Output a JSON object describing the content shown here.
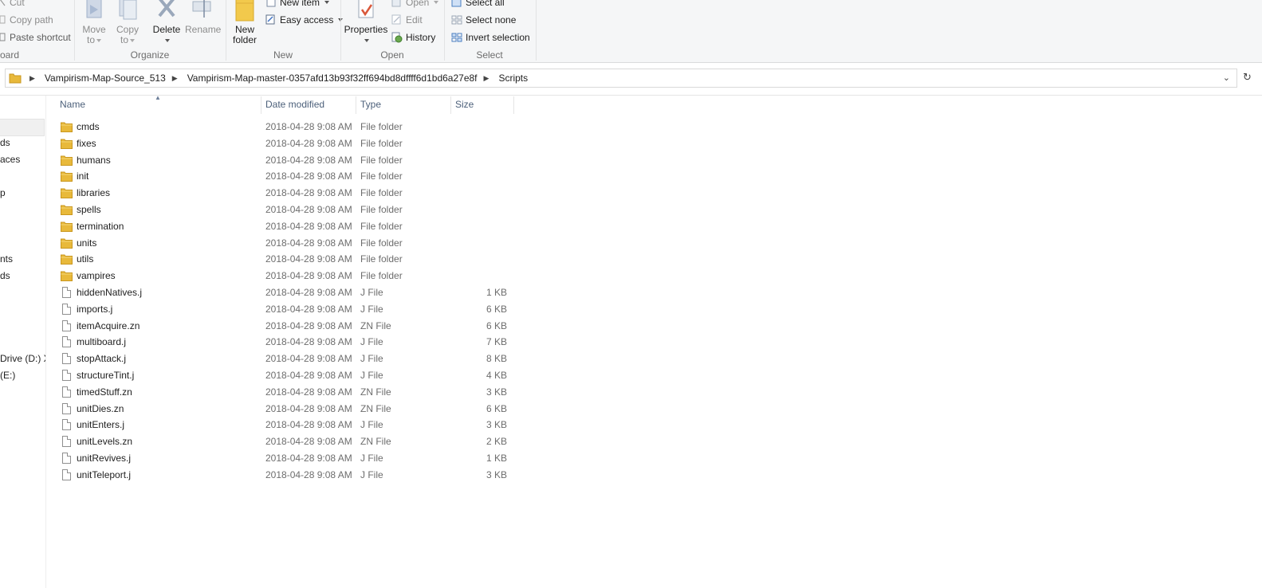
{
  "ribbon": {
    "clipboard": {
      "cut": "Cut",
      "copy_path": "Copy path",
      "paste_shortcut": "Paste shortcut",
      "label": "oard"
    },
    "organize": {
      "move_to_1": "Move",
      "move_to_2": "to",
      "copy_to_1": "Copy",
      "copy_to_2": "to",
      "delete": "Delete",
      "rename": "Rename",
      "label": "Organize"
    },
    "new": {
      "new_folder_1": "New",
      "new_folder_2": "folder",
      "new_item": "New item",
      "easy_access": "Easy access",
      "label": "New"
    },
    "open": {
      "properties": "Properties",
      "open": "Open",
      "edit": "Edit",
      "history": "History",
      "label": "Open"
    },
    "select": {
      "select_all": "Select all",
      "select_none": "Select none",
      "invert_selection": "Invert selection",
      "label": "Select"
    }
  },
  "address": {
    "crumbs": [
      "Vampirism-Map-Source_513",
      "Vampirism-Map-master-0357afd13b93f32ff694bd8dffff6d1bd6a27e8f",
      "Scripts"
    ]
  },
  "nav": {
    "items": [
      "ds",
      "aces",
      "p",
      "nts",
      "ds",
      "Drive (D:) X",
      "(E:)"
    ]
  },
  "columns": {
    "name": "Name",
    "date": "Date modified",
    "type": "Type",
    "size": "Size"
  },
  "files": [
    {
      "name": "cmds",
      "date": "2018-04-28 9:08 AM",
      "type": "File folder",
      "size": "",
      "kind": "folder"
    },
    {
      "name": "fixes",
      "date": "2018-04-28 9:08 AM",
      "type": "File folder",
      "size": "",
      "kind": "folder"
    },
    {
      "name": "humans",
      "date": "2018-04-28 9:08 AM",
      "type": "File folder",
      "size": "",
      "kind": "folder"
    },
    {
      "name": "init",
      "date": "2018-04-28 9:08 AM",
      "type": "File folder",
      "size": "",
      "kind": "folder"
    },
    {
      "name": "libraries",
      "date": "2018-04-28 9:08 AM",
      "type": "File folder",
      "size": "",
      "kind": "folder"
    },
    {
      "name": "spells",
      "date": "2018-04-28 9:08 AM",
      "type": "File folder",
      "size": "",
      "kind": "folder"
    },
    {
      "name": "termination",
      "date": "2018-04-28 9:08 AM",
      "type": "File folder",
      "size": "",
      "kind": "folder"
    },
    {
      "name": "units",
      "date": "2018-04-28 9:08 AM",
      "type": "File folder",
      "size": "",
      "kind": "folder"
    },
    {
      "name": "utils",
      "date": "2018-04-28 9:08 AM",
      "type": "File folder",
      "size": "",
      "kind": "folder"
    },
    {
      "name": "vampires",
      "date": "2018-04-28 9:08 AM",
      "type": "File folder",
      "size": "",
      "kind": "folder"
    },
    {
      "name": "hiddenNatives.j",
      "date": "2018-04-28 9:08 AM",
      "type": "J File",
      "size": "1 KB",
      "kind": "file"
    },
    {
      "name": "imports.j",
      "date": "2018-04-28 9:08 AM",
      "type": "J File",
      "size": "6 KB",
      "kind": "file"
    },
    {
      "name": "itemAcquire.zn",
      "date": "2018-04-28 9:08 AM",
      "type": "ZN File",
      "size": "6 KB",
      "kind": "file"
    },
    {
      "name": "multiboard.j",
      "date": "2018-04-28 9:08 AM",
      "type": "J File",
      "size": "7 KB",
      "kind": "file"
    },
    {
      "name": "stopAttack.j",
      "date": "2018-04-28 9:08 AM",
      "type": "J File",
      "size": "8 KB",
      "kind": "file"
    },
    {
      "name": "structureTint.j",
      "date": "2018-04-28 9:08 AM",
      "type": "J File",
      "size": "4 KB",
      "kind": "file"
    },
    {
      "name": "timedStuff.zn",
      "date": "2018-04-28 9:08 AM",
      "type": "ZN File",
      "size": "3 KB",
      "kind": "file"
    },
    {
      "name": "unitDies.zn",
      "date": "2018-04-28 9:08 AM",
      "type": "ZN File",
      "size": "6 KB",
      "kind": "file"
    },
    {
      "name": "unitEnters.j",
      "date": "2018-04-28 9:08 AM",
      "type": "J File",
      "size": "3 KB",
      "kind": "file"
    },
    {
      "name": "unitLevels.zn",
      "date": "2018-04-28 9:08 AM",
      "type": "ZN File",
      "size": "2 KB",
      "kind": "file"
    },
    {
      "name": "unitRevives.j",
      "date": "2018-04-28 9:08 AM",
      "type": "J File",
      "size": "1 KB",
      "kind": "file"
    },
    {
      "name": "unitTeleport.j",
      "date": "2018-04-28 9:08 AM",
      "type": "J File",
      "size": "3 KB",
      "kind": "file"
    }
  ],
  "colors": {
    "folder": "#e8b93b",
    "header_text": "#4c607a",
    "muted_text": "#6d6d6d"
  }
}
